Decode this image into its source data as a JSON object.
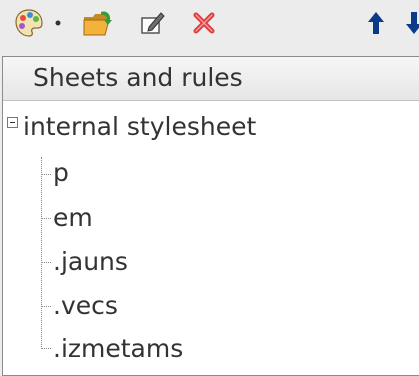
{
  "toolbar": {
    "buttons": [
      {
        "icon": "palette-icon",
        "has_dropdown": true
      },
      {
        "icon": "folder-open-icon"
      },
      {
        "icon": "edit-icon"
      },
      {
        "icon": "delete-icon"
      },
      {
        "icon": "arrow-up-icon"
      },
      {
        "icon": "arrow-down-icon"
      }
    ]
  },
  "tree": {
    "header": "Sheets and rules",
    "root": {
      "label": "internal stylesheet",
      "expanded": true,
      "children": [
        "p",
        "em",
        ".jauns",
        ".vecs",
        ".izmetams"
      ]
    }
  },
  "colors": {
    "arrow": "#0a3a8a",
    "delete": "#e03a3a",
    "folder": "#f2b23b"
  }
}
